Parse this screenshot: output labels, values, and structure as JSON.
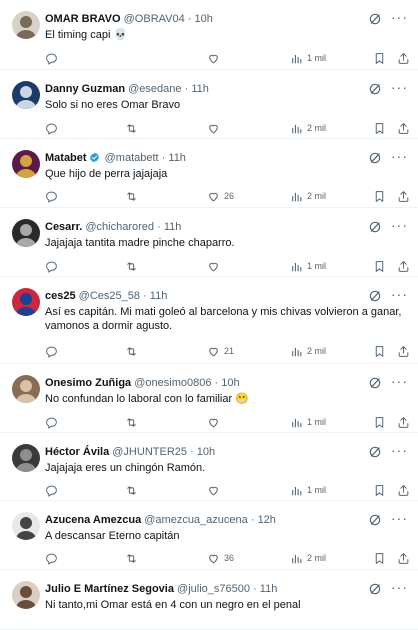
{
  "tweets": [
    {
      "name": "OMAR BRAVO",
      "handle": "@OBRAV04",
      "sep": "·",
      "time": "10h",
      "text": "El timing capi 💀",
      "verified": false,
      "reply_count": "",
      "retweet_count": "",
      "like_count": "",
      "views": "1 mil",
      "show_retweet_icon": false,
      "avatar_colors": [
        "#d8d1c7",
        "#7a6a58"
      ]
    },
    {
      "name": "Danny Guzman",
      "handle": "@esedane",
      "sep": "·",
      "time": "11h",
      "text": "Solo si no eres Omar Bravo",
      "verified": false,
      "reply_count": "",
      "retweet_count": "",
      "like_count": "",
      "views": "2 mil",
      "show_retweet_icon": true,
      "avatar_colors": [
        "#1d3b6a",
        "#c9d6e6"
      ]
    },
    {
      "name": "Matabet",
      "handle": "@matabett",
      "sep": "·",
      "time": "11h",
      "text": "Que hijo de perra jajajaja",
      "verified": true,
      "reply_count": "",
      "retweet_count": "",
      "like_count": "26",
      "views": "2 mil",
      "show_retweet_icon": true,
      "avatar_colors": [
        "#5b1a4a",
        "#d2a340"
      ]
    },
    {
      "name": "Cesarr.",
      "handle": "@chicharored",
      "sep": "·",
      "time": "11h",
      "text": "Jajajaja tantita madre pinche chaparro.",
      "verified": false,
      "reply_count": "",
      "retweet_count": "",
      "like_count": "",
      "views": "1 mil",
      "show_retweet_icon": true,
      "avatar_colors": [
        "#2a2a2a",
        "#a8a8a8"
      ]
    },
    {
      "name": "ces25",
      "handle": "@Ces25_58",
      "sep": "·",
      "time": "11h",
      "text": "Así es capitán. Mi mati goleó al barcelona y mis chivas volvieron a ganar, vamonos a dormir agusto.",
      "verified": false,
      "reply_count": "",
      "retweet_count": "",
      "like_count": "21",
      "views": "2 mil",
      "show_retweet_icon": true,
      "avatar_colors": [
        "#c9283e",
        "#1f3f8f"
      ]
    },
    {
      "name": "Onesimo Zuñiga",
      "handle": "@onesimo0806",
      "sep": "·",
      "time": "10h",
      "text": "No confundan lo laboral con lo familiar 😬",
      "verified": false,
      "reply_count": "",
      "retweet_count": "",
      "like_count": "",
      "views": "1 mil",
      "show_retweet_icon": true,
      "avatar_colors": [
        "#8a6c52",
        "#d8c3a8"
      ]
    },
    {
      "name": "Héctor Ávila",
      "handle": "@JHUNTER25",
      "sep": "·",
      "time": "10h",
      "text": "Jajajaja eres un chingón Ramón.",
      "verified": false,
      "reply_count": "",
      "retweet_count": "",
      "like_count": "",
      "views": "1 mil",
      "show_retweet_icon": true,
      "avatar_colors": [
        "#3a3a3a",
        "#8e8e8e"
      ]
    },
    {
      "name": "Azucena Amezcua",
      "handle": "@amezcua_azucena",
      "sep": "·",
      "time": "12h",
      "text": "A descansar Eterno capitán",
      "verified": false,
      "reply_count": "",
      "retweet_count": "",
      "like_count": "36",
      "views": "2 mil",
      "show_retweet_icon": true,
      "avatar_colors": [
        "#e8e8e8",
        "#444444"
      ]
    },
    {
      "name": "Julio E Martínez Segovia",
      "handle": "@julio_s76500",
      "sep": "·",
      "time": "11h",
      "text": "Ni tanto,mi Omar está en 4 con un negro en el penal",
      "verified": false,
      "reply_count": "",
      "retweet_count": "",
      "like_count": "",
      "views": "",
      "show_retweet_icon": false,
      "avatar_colors": [
        "#d9cfc4",
        "#6b4e3a"
      ]
    }
  ],
  "icons": {
    "reply": "reply-icon",
    "retweet": "retweet-icon",
    "like": "heart-icon",
    "views": "views-chart-icon",
    "bookmark": "bookmark-icon",
    "share": "share-icon",
    "grok": "grok-icon",
    "more": "more-icon"
  },
  "colors": {
    "text": "#0f1419",
    "secondary": "#536471",
    "divider": "#eff3f4",
    "verified": "#1d9bf0"
  }
}
